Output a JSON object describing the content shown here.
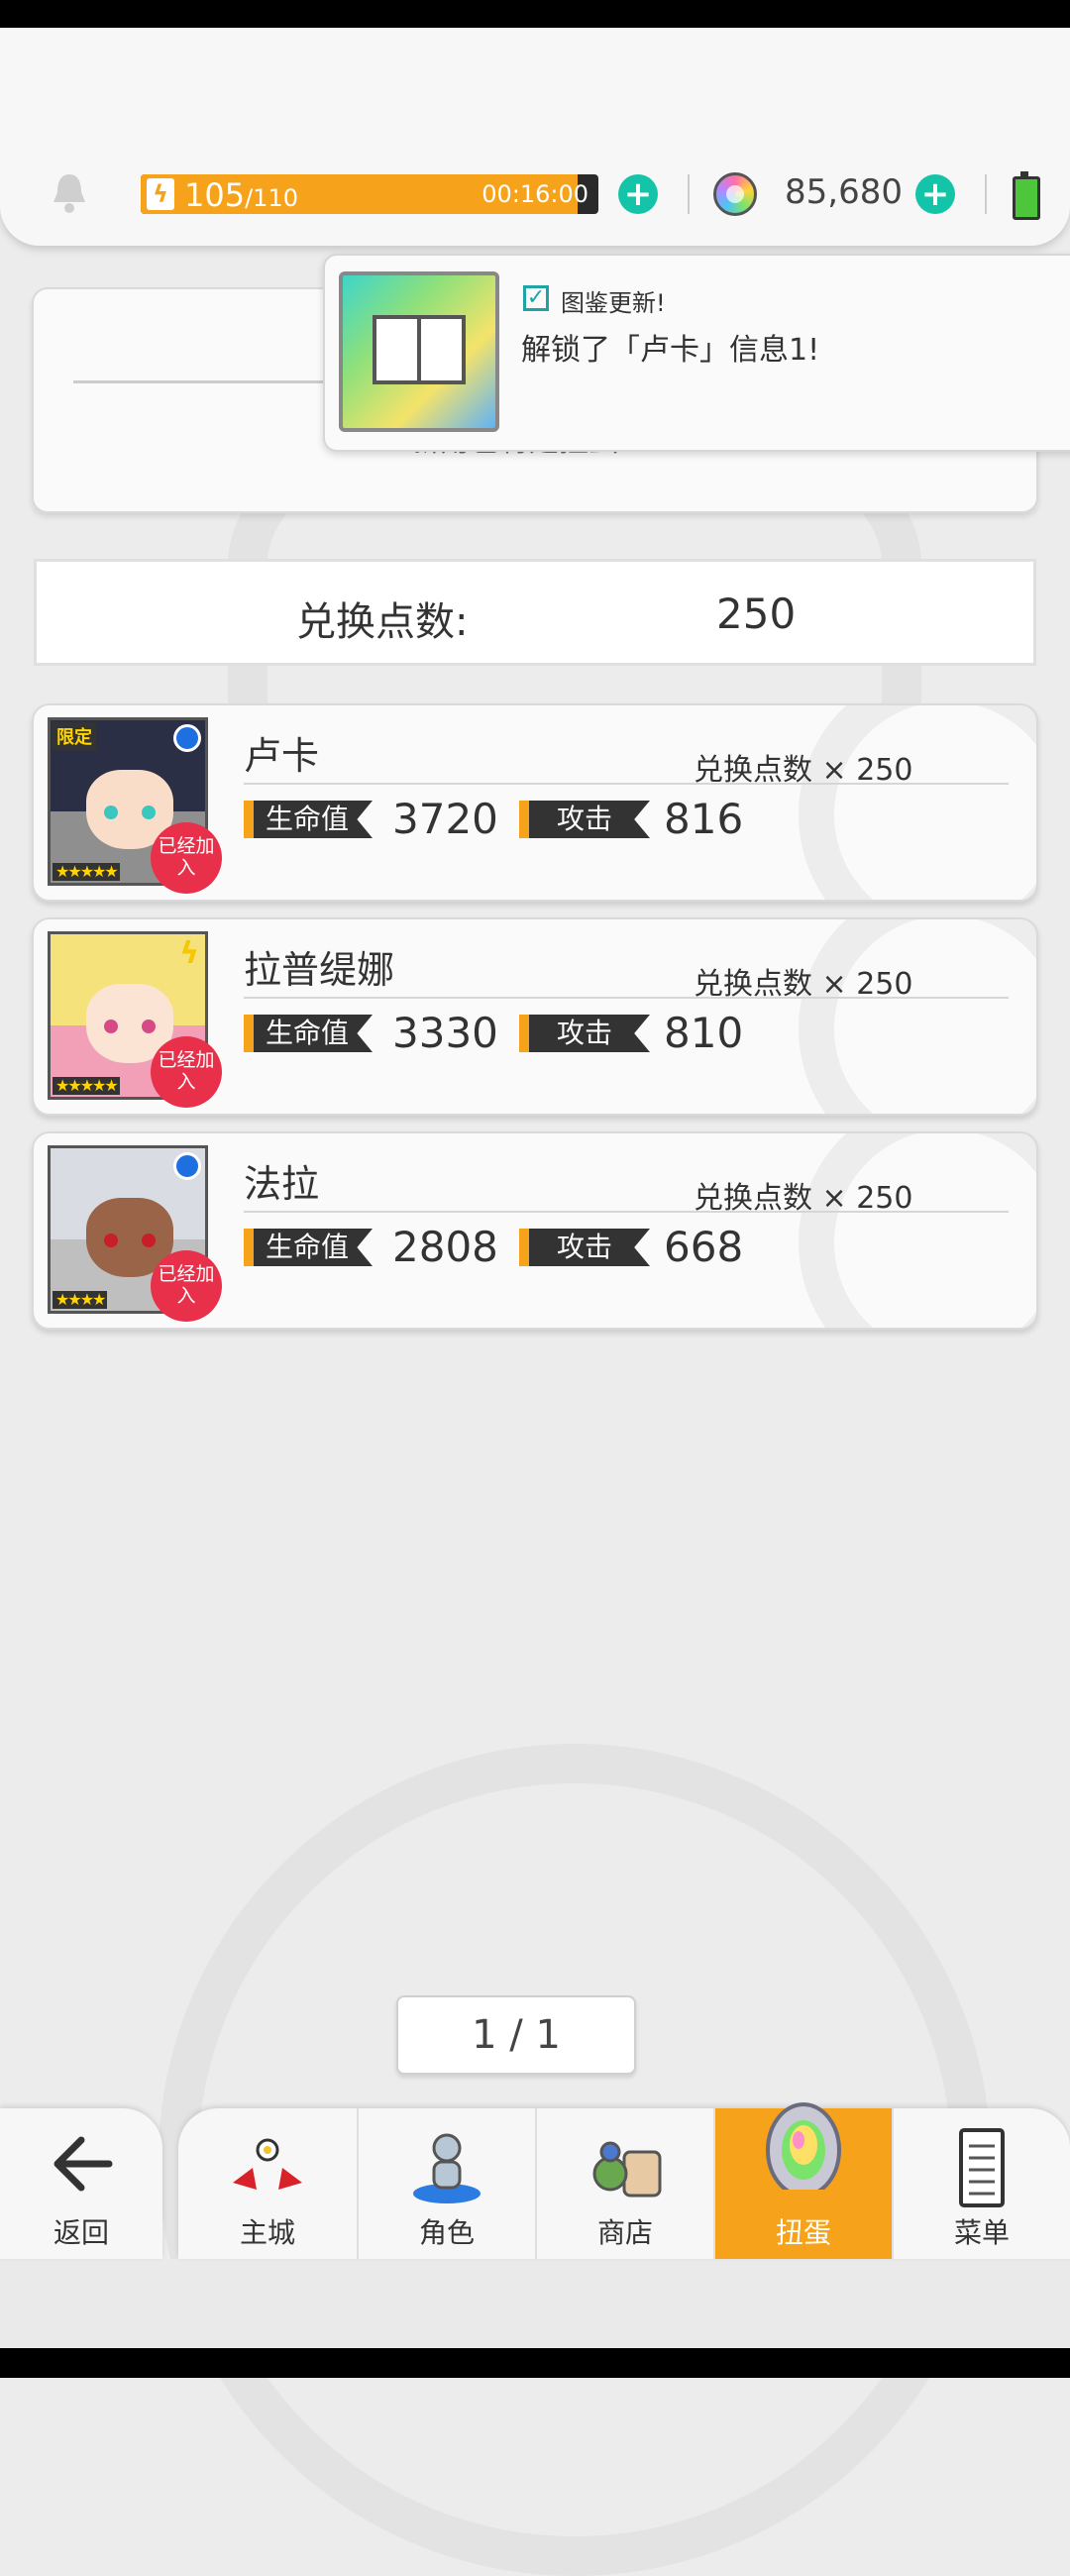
{
  "header": {
    "energy_current": "105",
    "energy_max": "/110",
    "energy_timer": "00:16:00",
    "energy_fraction": 0.954,
    "gems": "85,680"
  },
  "notification": {
    "title": "图鉴更新!",
    "message": "解锁了「卢卡」信息1!"
  },
  "panel": {
    "partial_text": "新角色将是扭蛋"
  },
  "exchange": {
    "label": "兑换点数:",
    "value": "250"
  },
  "characters": [
    {
      "name": "卢卡",
      "cost": "兑换点数 × 250",
      "hp_label": "生命值",
      "hp": "3720",
      "atk_label": "攻击",
      "atk": "816",
      "stars": "★★★★★",
      "limited": "限定",
      "joined": "已经加入"
    },
    {
      "name": "拉普缇娜",
      "cost": "兑换点数 × 250",
      "hp_label": "生命值",
      "hp": "3330",
      "atk_label": "攻击",
      "atk": "810",
      "stars": "★★★★★",
      "joined": "已经加入"
    },
    {
      "name": "法拉",
      "cost": "兑换点数 × 250",
      "hp_label": "生命值",
      "hp": "2808",
      "atk_label": "攻击",
      "atk": "668",
      "stars": "★★★★",
      "joined": "已经加入"
    }
  ],
  "pager": "1 / 1",
  "nav": {
    "back": "返回",
    "tabs": [
      "主城",
      "角色",
      "商店",
      "扭蛋",
      "菜单"
    ],
    "active": "扭蛋"
  },
  "colors": {
    "accent": "#f7a21b",
    "teal": "#14c4a8",
    "badge_red": "#e8304a"
  }
}
